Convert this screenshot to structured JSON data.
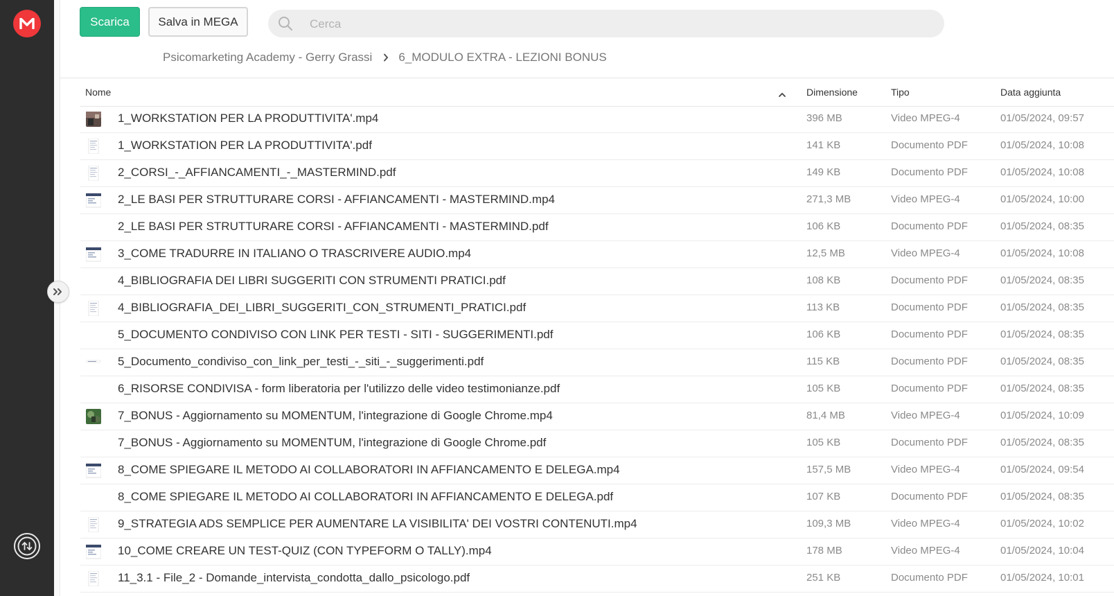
{
  "toolbar": {
    "download_label": "Scarica",
    "save_label": "Salva in MEGA"
  },
  "search": {
    "placeholder": "Cerca",
    "value": ""
  },
  "breadcrumb": {
    "root": "Psicomarketing Academy - Gerry Grassi",
    "current": "6_MODULO EXTRA - LEZIONI BONUS"
  },
  "table": {
    "headers": {
      "name": "Nome",
      "size": "Dimensione",
      "type": "Tipo",
      "date": "Data aggiunta"
    },
    "rows": [
      {
        "name": "1_WORKSTATION PER LA PRODUTTIVITA'.mp4",
        "size": "396 MB",
        "type": "Video MPEG-4",
        "date": "01/05/2024, 09:57",
        "thumb": "video-photo"
      },
      {
        "name": "1_WORKSTATION PER LA PRODUTTIVITA'.pdf",
        "size": "141 KB",
        "type": "Documento PDF",
        "date": "01/05/2024, 10:08",
        "thumb": "doc"
      },
      {
        "name": "2_CORSI_-_AFFIANCAMENTI_-_MASTERMIND.pdf",
        "size": "149 KB",
        "type": "Documento PDF",
        "date": "01/05/2024, 10:08",
        "thumb": "doc"
      },
      {
        "name": "2_LE BASI PER STRUTTURARE CORSI - AFFIANCAMENTI - MASTERMIND.mp4",
        "size": "271,3 MB",
        "type": "Video MPEG-4",
        "date": "01/05/2024, 10:00",
        "thumb": "video-screen"
      },
      {
        "name": "2_LE BASI PER STRUTTURARE CORSI - AFFIANCAMENTI - MASTERMIND.pdf",
        "size": "106 KB",
        "type": "Documento PDF",
        "date": "01/05/2024, 08:35",
        "thumb": "none"
      },
      {
        "name": "3_COME TRADURRE IN ITALIANO O TRASCRIVERE AUDIO.mp4",
        "size": "12,5 MB",
        "type": "Video MPEG-4",
        "date": "01/05/2024, 10:08",
        "thumb": "video-screen"
      },
      {
        "name": "4_BIBLIOGRAFIA DEI LIBRI SUGGERITI CON STRUMENTI PRATICI.pdf",
        "size": "108 KB",
        "type": "Documento PDF",
        "date": "01/05/2024, 08:35",
        "thumb": "none"
      },
      {
        "name": "4_BIBLIOGRAFIA_DEI_LIBRI_SUGGERITI_CON_STRUMENTI_PRATICI.pdf",
        "size": "113 KB",
        "type": "Documento PDF",
        "date": "01/05/2024, 08:35",
        "thumb": "doc"
      },
      {
        "name": "5_DOCUMENTO CONDIVISO CON LINK PER TESTI - SITI - SUGGERIMENTI.pdf",
        "size": "106 KB",
        "type": "Documento PDF",
        "date": "01/05/2024, 08:35",
        "thumb": "none"
      },
      {
        "name": "5_Documento_condiviso_con_link_per_testi_-_siti_-_suggerimenti.pdf",
        "size": "115 KB",
        "type": "Documento PDF",
        "date": "01/05/2024, 08:35",
        "thumb": "doc-small"
      },
      {
        "name": "6_RISORSE CONDIVISA - form liberatoria per l'utilizzo delle video testimonianze.pdf",
        "size": "105 KB",
        "type": "Documento PDF",
        "date": "01/05/2024, 08:35",
        "thumb": "none"
      },
      {
        "name": "7_BONUS - Aggiornamento su MOMENTUM, l'integrazione di Google Chrome.mp4",
        "size": "81,4 MB",
        "type": "Video MPEG-4",
        "date": "01/05/2024, 10:09",
        "thumb": "video-photo-green"
      },
      {
        "name": "7_BONUS - Aggiornamento su MOMENTUM, l'integrazione di Google Chrome.pdf",
        "size": "105 KB",
        "type": "Documento PDF",
        "date": "01/05/2024, 08:35",
        "thumb": "none"
      },
      {
        "name": "8_COME SPIEGARE IL METODO AI COLLABORATORI IN AFFIANCAMENTO E DELEGA.mp4",
        "size": "157,5 MB",
        "type": "Video MPEG-4",
        "date": "01/05/2024, 09:54",
        "thumb": "video-screen"
      },
      {
        "name": "8_COME SPIEGARE IL METODO AI COLLABORATORI IN AFFIANCAMENTO E DELEGA.pdf",
        "size": "107 KB",
        "type": "Documento PDF",
        "date": "01/05/2024, 08:35",
        "thumb": "none"
      },
      {
        "name": "9_STRATEGIA ADS SEMPLICE PER AUMENTARE LA VISIBILITA' DEI VOSTRI CONTENUTI.mp4",
        "size": "109,3 MB",
        "type": "Video MPEG-4",
        "date": "01/05/2024, 10:02",
        "thumb": "doc"
      },
      {
        "name": "10_COME CREARE UN TEST-QUIZ (CON TYPEFORM O TALLY).mp4",
        "size": "178 MB",
        "type": "Video MPEG-4",
        "date": "01/05/2024, 10:04",
        "thumb": "video-screen"
      },
      {
        "name": "11_3.1 - File_2 - Domande_intervista_condotta_dallo_psicologo.pdf",
        "size": "251 KB",
        "type": "Documento PDF",
        "date": "01/05/2024, 10:01",
        "thumb": "doc"
      }
    ]
  },
  "icons": {
    "logo": "mega-logo-icon",
    "search": "search-icon",
    "breadcrumb_sep": "chevron-right-icon",
    "sort": "chevron-up-icon",
    "expand": "double-chevron-right-icon",
    "transfers": "transfers-icon"
  },
  "colors": {
    "accent": "#2bbd8a",
    "brand": "#f0373a",
    "sidebar": "#2d2d2d"
  }
}
